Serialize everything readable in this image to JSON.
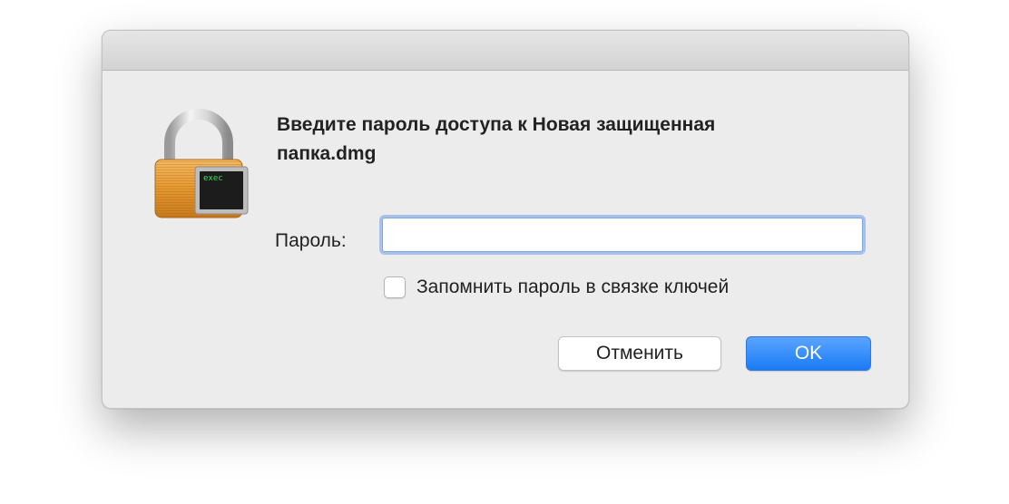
{
  "dialog": {
    "title": "Введите пароль доступа к Новая защищенная папка.dmg",
    "password_label": "Пароль:",
    "password_value": "",
    "remember_label": "Запомнить пароль в связке ключей",
    "remember_checked": false,
    "cancel_label": "Отменить",
    "ok_label": "OK"
  },
  "icon": {
    "name": "lock-exec-icon",
    "badge_text": "exec"
  },
  "colors": {
    "accent": "#1a7bf5",
    "focus_ring": "#6ea0eb",
    "lock_body": "#e89b3a"
  }
}
